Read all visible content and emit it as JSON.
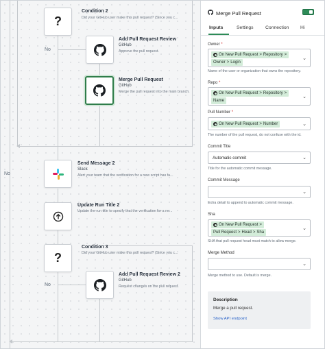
{
  "canvas": {
    "no_label": "No",
    "nodes": [
      {
        "title": "Condition 2",
        "subtitle": "",
        "desc": "Did your GitHub user make this pull request? (Since you c..."
      },
      {
        "title": "Add Pull Request Review",
        "subtitle": "GitHub",
        "desc": "Approve the pull request."
      },
      {
        "title": "Merge Pull Request",
        "subtitle": "GitHub",
        "desc": "Merge the pull request into the main branch."
      },
      {
        "title": "Send Message 2",
        "subtitle": "Slack",
        "desc": "Alert your team that the verification for a new script has fa..."
      },
      {
        "title": "Update Run Title 2",
        "subtitle": "",
        "desc": "Update the run title to specify that the verification for a ne..."
      },
      {
        "title": "Condition 3",
        "subtitle": "",
        "desc": "Did your GitHub user make this pull request? (Since you c..."
      },
      {
        "title": "Add Pull Request Review 2",
        "subtitle": "GitHub",
        "desc": "Request changes on the pull request."
      }
    ]
  },
  "panel": {
    "title": "Merge Pull Request",
    "toggle_on": true,
    "tabs": [
      "Inputs",
      "Settings",
      "Connection",
      "Hi"
    ],
    "active_tab": "Inputs",
    "owner": {
      "label": "Owner",
      "required_mark": "*",
      "pills": [
        "On New Pull Request",
        "Repository",
        "Owner",
        "Login"
      ],
      "help": "Name of the user or organization that owns the repository."
    },
    "repo": {
      "label": "Repo",
      "required_mark": "*",
      "pills": [
        "On New Pull Request",
        "Repository",
        "Name"
      ]
    },
    "pull_number": {
      "label": "Pull Number",
      "required_mark": "*",
      "pills": [
        "On New Pull Request",
        "Number"
      ],
      "help": "The number of the pull request, do not confuse with the id."
    },
    "commit_title": {
      "label": "Commit Title",
      "value": "Automatic commit",
      "help": "Title for the automatic commit message."
    },
    "commit_message": {
      "label": "Commit Message",
      "value": "",
      "help": "Extra detail to append to automatic commit message."
    },
    "sha": {
      "label": "Sha",
      "pills": [
        "On New Pull Request",
        "Pull Request",
        "Head",
        "Sha"
      ],
      "help": "SHA that pull request head must match to allow merge."
    },
    "merge_method": {
      "label": "Merge Method",
      "value": "",
      "help": "Merge method to use. Default is merge."
    },
    "description": {
      "heading": "Description",
      "text": "Merge a pull request.",
      "link": "Show API endpoint"
    },
    "chevron": ">"
  },
  "colors": {
    "accent": "#2e8b57",
    "pill": "#d3ecd9",
    "link": "#2b64c8"
  }
}
